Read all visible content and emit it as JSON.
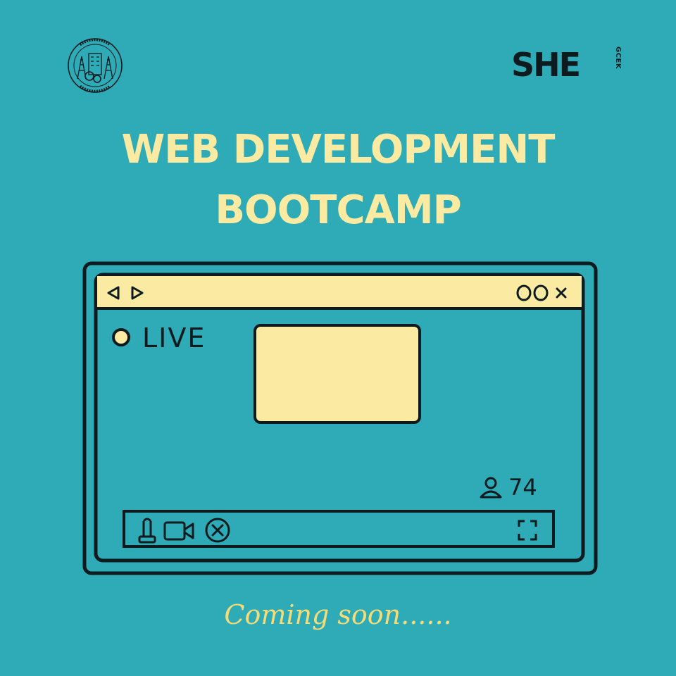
{
  "header": {
    "college_seal": "gear-tower-seal-icon",
    "brand": {
      "main": "SHE",
      "sub": "GCEK"
    }
  },
  "title": {
    "line1": "WEB DEVELOPMENT",
    "line2": "BOOTCAMP"
  },
  "browser_mockup": {
    "nav_icons": [
      "back-arrow-icon",
      "forward-arrow-icon"
    ],
    "window_icons": [
      "minimize-circle-icon",
      "maximize-circle-icon",
      "close-x-icon"
    ],
    "live_label": "LIVE",
    "viewer_count": "74",
    "viewer_icon": "user-icon",
    "controls": [
      "microphone-icon",
      "camera-icon",
      "end-call-icon",
      "fullscreen-icon"
    ]
  },
  "tagline": "Coming soon......",
  "colors": {
    "background": "#2eabb6",
    "accent": "#faeaa2",
    "ink": "#0e1b1e",
    "tagline": "#f5dc78"
  }
}
